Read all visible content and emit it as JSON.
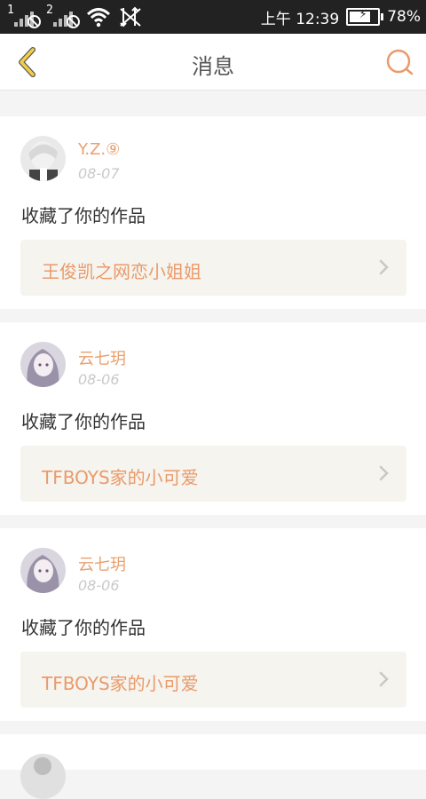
{
  "status_bar": {
    "sim1": "1",
    "sim2": "2",
    "time": "上午 12:39",
    "battery_percent": "78%",
    "battery_level": 0.78
  },
  "header": {
    "title": "消息"
  },
  "colors": {
    "accent": "#ea9a6a",
    "back_icon": "#f2cd4a",
    "page_bg": "#f4f4f4",
    "work_bg": "#f5f4ef"
  },
  "messages": [
    {
      "user": "Y.Z.⑨",
      "date": "08-07",
      "action": "收藏了你的作品",
      "work_title": "王俊凯之网恋小姐姐"
    },
    {
      "user": "云七玥",
      "date": "08-06",
      "action": "收藏了你的作品",
      "work_title": "TFBOYS家的小可爱"
    },
    {
      "user": "云七玥",
      "date": "08-06",
      "action": "收藏了你的作品",
      "work_title": "TFBOYS家的小可爱"
    }
  ]
}
